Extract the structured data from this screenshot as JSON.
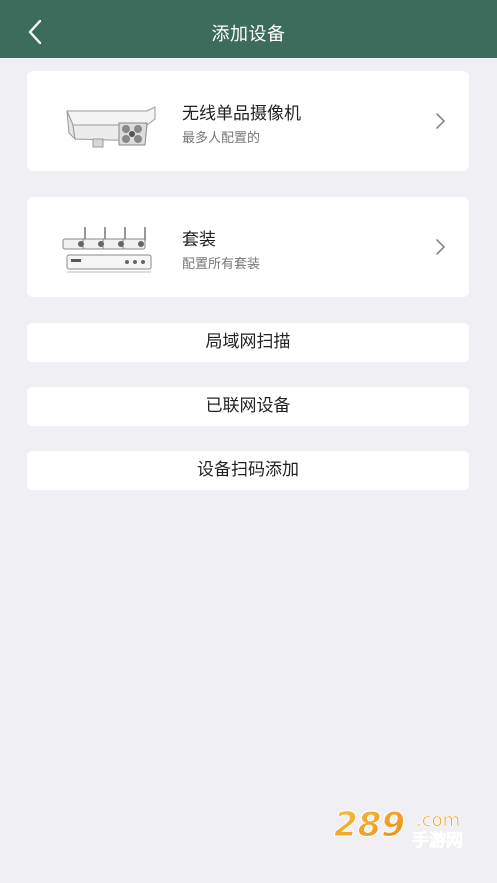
{
  "header": {
    "title": "添加设备",
    "back_icon": "chevron-left-icon",
    "background": "#3d6b5c"
  },
  "cards": [
    {
      "title": "无线单品摄像机",
      "subtitle": "最多人配置的",
      "image": "bullet-camera-image",
      "arrow_icon": "chevron-right-icon"
    },
    {
      "title": "套装",
      "subtitle": "配置所有套装",
      "image": "nvr-kit-image",
      "arrow_icon": "chevron-right-icon"
    }
  ],
  "buttons": {
    "lan_scan": "局域网扫描",
    "connected_devices": "已联网设备",
    "scan_code_add": "设备扫码添加"
  },
  "watermark": {
    "brand": "289",
    "domain": ".com",
    "tagline": "手游网"
  }
}
